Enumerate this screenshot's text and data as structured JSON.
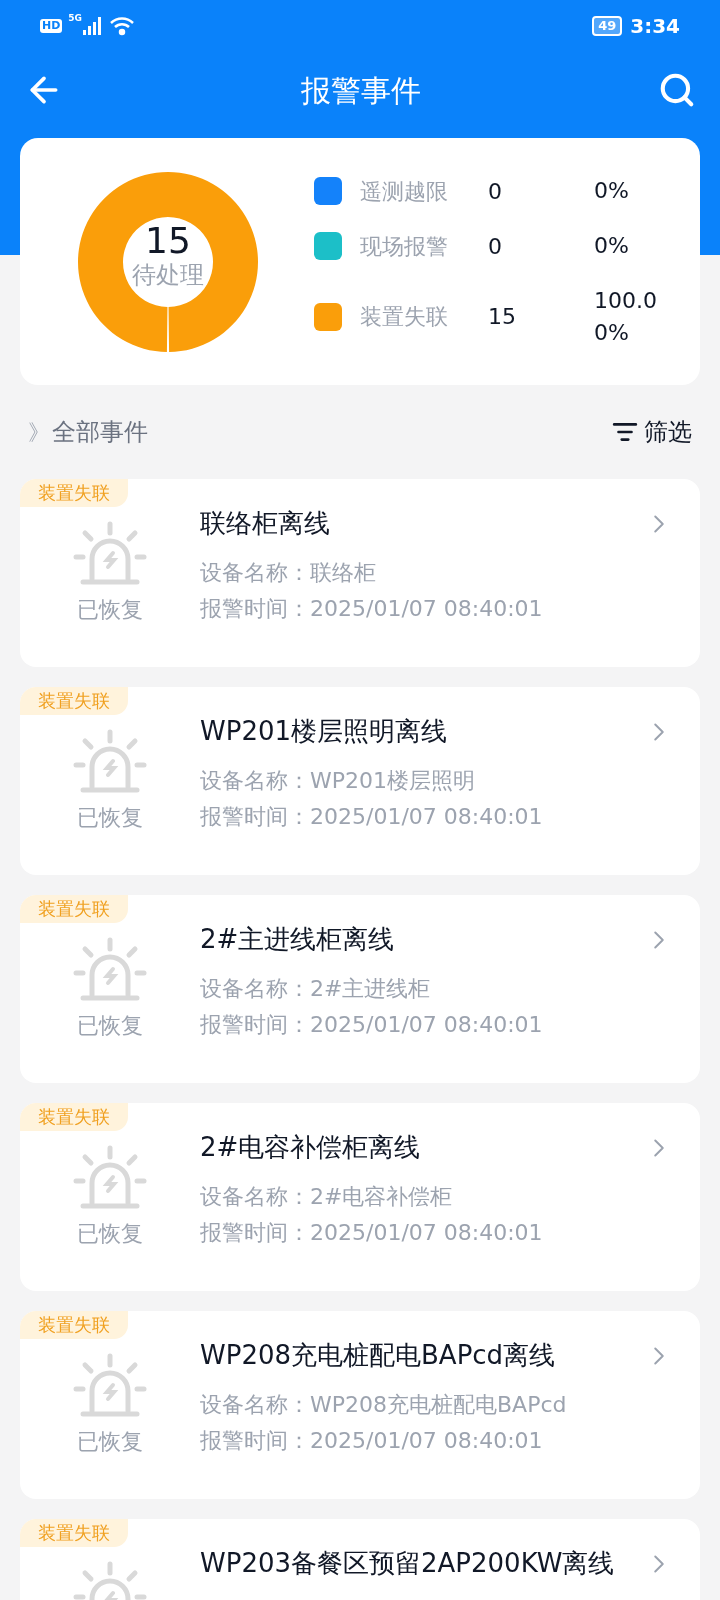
{
  "status_bar": {
    "hd": "HD",
    "network": "5G",
    "battery": "49",
    "time": "3:34"
  },
  "header": {
    "title": "报警事件"
  },
  "summary": {
    "center_value": "15",
    "center_label": "待处理",
    "legend": [
      {
        "label": "遥测越限",
        "count": "0",
        "percent": "0%",
        "color": "#1482fa"
      },
      {
        "label": "现场报警",
        "count": "0",
        "percent": "0%",
        "color": "#1cbfc8"
      },
      {
        "label": "装置失联",
        "count": "15",
        "percent": "100.00%",
        "color": "#fa9e0a"
      }
    ]
  },
  "list_header": {
    "mark": "》",
    "title": "全部事件",
    "filter": "筛选"
  },
  "events": [
    {
      "tag": "装置失联",
      "status": "已恢复",
      "title": "联络柜离线",
      "device_label": "设备名称：",
      "device": "联络柜",
      "time_label": "报警时间：",
      "time": "2025/01/07 08:40:01"
    },
    {
      "tag": "装置失联",
      "status": "已恢复",
      "title": "WP201楼层照明离线",
      "device_label": "设备名称：",
      "device": "WP201楼层照明",
      "time_label": "报警时间：",
      "time": "2025/01/07 08:40:01"
    },
    {
      "tag": "装置失联",
      "status": "已恢复",
      "title": "2#主进线柜离线",
      "device_label": "设备名称：",
      "device": "2#主进线柜",
      "time_label": "报警时间：",
      "time": "2025/01/07 08:40:01"
    },
    {
      "tag": "装置失联",
      "status": "已恢复",
      "title": "2#电容补偿柜离线",
      "device_label": "设备名称：",
      "device": "2#电容补偿柜",
      "time_label": "报警时间：",
      "time": "2025/01/07 08:40:01"
    },
    {
      "tag": "装置失联",
      "status": "已恢复",
      "title": "WP208充电桩配电BAPcd离线",
      "device_label": "设备名称：",
      "device": "WP208充电桩配电BAPcd",
      "time_label": "报警时间：",
      "time": "2025/01/07 08:40:01"
    },
    {
      "tag": "装置失联",
      "title": "WP203备餐区预留2AP200KW离线"
    }
  ]
}
